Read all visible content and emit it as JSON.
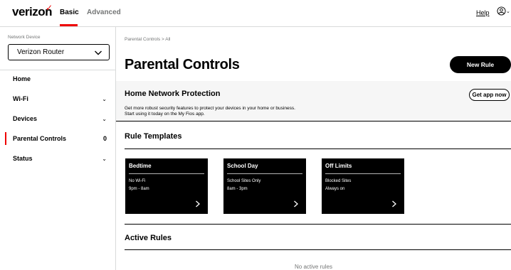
{
  "header": {
    "logo_text": "verizon",
    "tabs": [
      {
        "label": "Basic",
        "active": true
      },
      {
        "label": "Advanced",
        "active": false
      }
    ],
    "help_label": "Help",
    "user_icon": "user-circle-icon",
    "accent_color": "#ee0000"
  },
  "sidebar": {
    "device_label": "Network Device",
    "device_value": "Verizon Router",
    "items": [
      {
        "label": "Home",
        "chevron": false,
        "count": ""
      },
      {
        "label": "Wi-Fi",
        "chevron": true,
        "count": ""
      },
      {
        "label": "Devices",
        "chevron": true,
        "count": ""
      },
      {
        "label": "Parental Controls",
        "chevron": false,
        "count": "0",
        "active": true
      },
      {
        "label": "Status",
        "chevron": true,
        "count": ""
      }
    ]
  },
  "main": {
    "breadcrumb": "Parental Controls  >  All",
    "title": "Parental Controls",
    "new_rule_label": "New Rule",
    "protection": {
      "title": "Home Network Protection",
      "text_line1": "Get more robust security features to protect your devices in your home or business.",
      "text_line2": "Start using it today on the My Fios app.",
      "button_label": "Get app now"
    },
    "templates_title": "Rule Templates",
    "templates": [
      {
        "title": "Bedtime",
        "line1": "No Wi-Fi",
        "line2": "9pm - 8am"
      },
      {
        "title": "School Day",
        "line1": "School Sites Only",
        "line2": "8am - 3pm"
      },
      {
        "title": "Off Limits",
        "line1": "Blocked Sites",
        "line2": "Always on"
      }
    ],
    "active_rules_title": "Active Rules",
    "no_rules_text": "No active rules"
  }
}
